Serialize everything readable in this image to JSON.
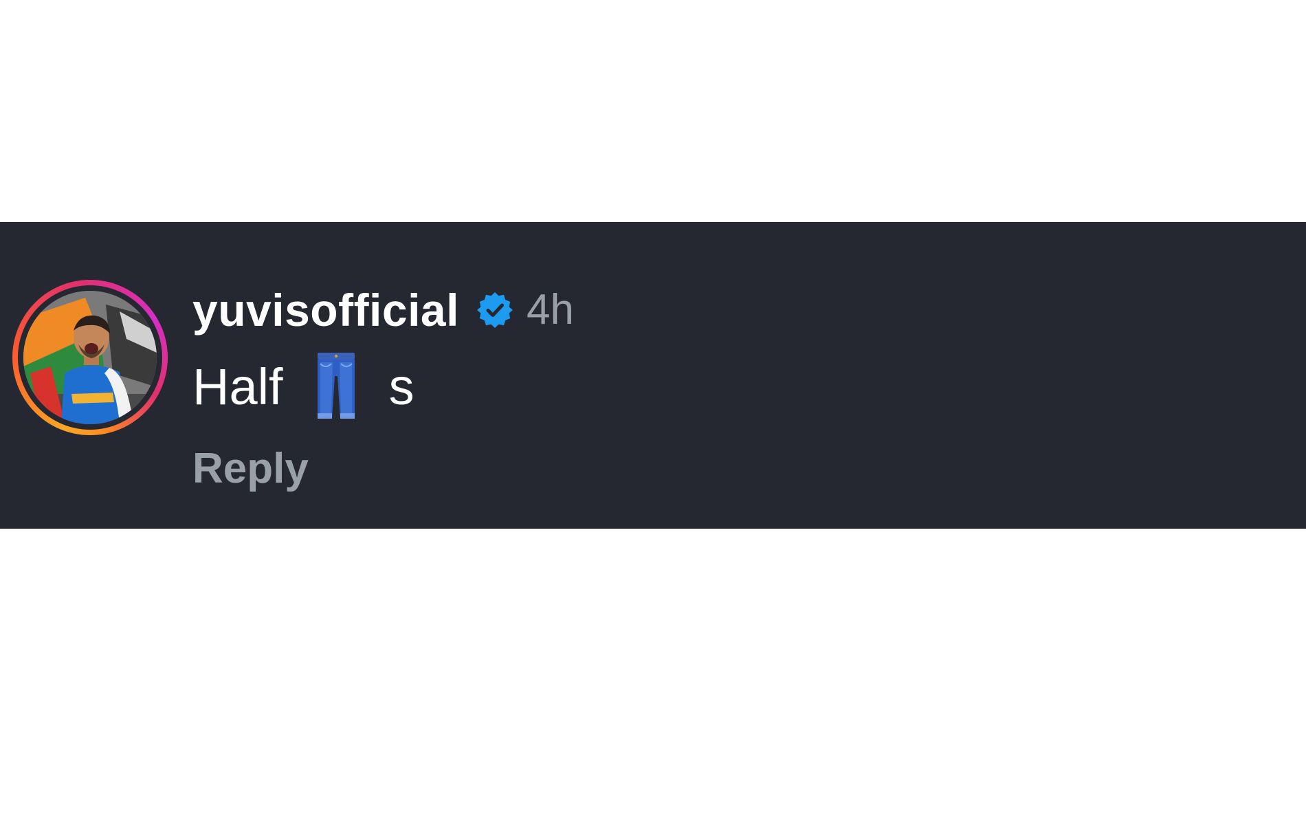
{
  "comment": {
    "username": "yuvisofficial",
    "verified": true,
    "timestamp": "4h",
    "text_before_emoji": "Half",
    "emoji_name": "jeans",
    "text_after_emoji": "s",
    "reply_label": "Reply",
    "avatar_icon": "profile-photo"
  },
  "colors": {
    "background_band": "#252830",
    "page_background": "#ffffff",
    "username": "#ffffff",
    "muted_text": "#9aa0aa",
    "verified_badge": "#1d9bf0"
  }
}
